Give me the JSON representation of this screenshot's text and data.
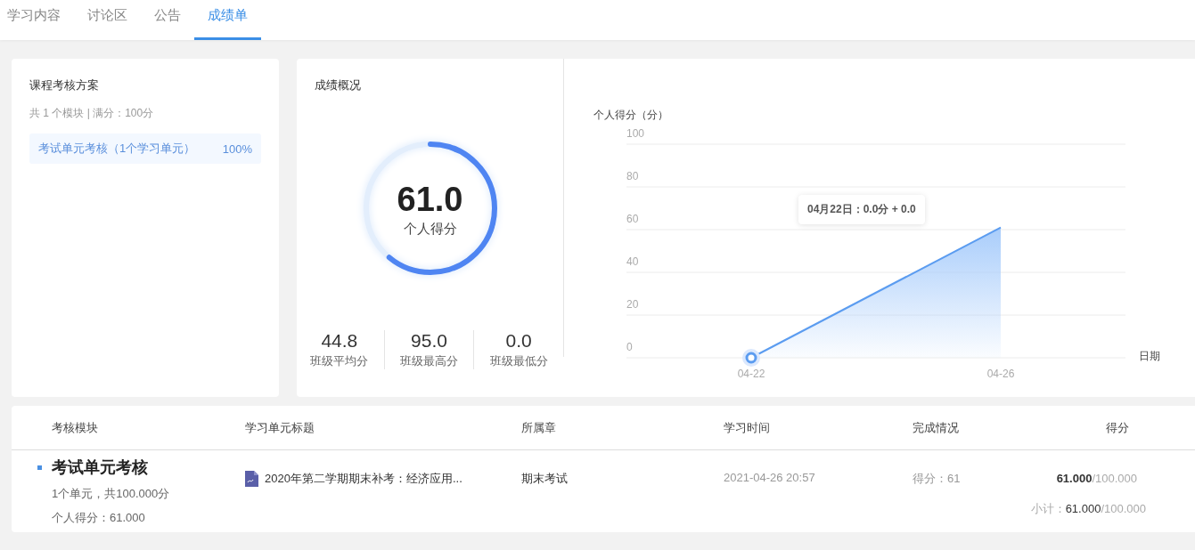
{
  "tabs": [
    {
      "label": "学习内容",
      "selected": false
    },
    {
      "label": "讨论区",
      "selected": false
    },
    {
      "label": "公告",
      "selected": false
    },
    {
      "label": "成绩单",
      "selected": true
    }
  ],
  "scheme": {
    "title": "课程考核方案",
    "summary": "共 1 个模块 | 满分：100分",
    "items": [
      {
        "label": "考试单元考核（1个学习单元）",
        "percent": "100%",
        "selected": true
      }
    ]
  },
  "overview": {
    "title": "成绩概况",
    "score": {
      "value": "61.0",
      "label": "个人得分",
      "level": 0.61
    },
    "stats": [
      {
        "value": "44.8",
        "label": "班级平均分"
      },
      {
        "value": "95.0",
        "label": "班级最高分"
      },
      {
        "value": "0.0",
        "label": "班级最低分"
      }
    ],
    "chart_data": {
      "type": "area",
      "ylabel": "个人得分（分）",
      "xlabel": "日期",
      "categories": [
        "04-22",
        "04-26"
      ],
      "series": [
        {
          "color": "#5b9cf0",
          "values": [
            0,
            61
          ]
        }
      ],
      "grid": true,
      "ylim": [
        0,
        100
      ],
      "yticks": [
        0,
        20,
        40,
        60,
        80,
        100
      ],
      "annotations": [
        "04月22日：0.0分 + 0.0"
      ]
    }
  },
  "table": {
    "columns": [
      "考核模块",
      "学习单元标题",
      "所属章",
      "学习时间",
      "完成情况",
      "得分"
    ],
    "rows": [
      {
        "module": "考试单元考核",
        "units": "1个单元，共100.000分",
        "personal": "个人得分：61.000",
        "title": "2020年第二学期期末补考：经济应用...",
        "chapter": "期末考试",
        "time": "2021-04-26 20:57",
        "completion": "得分：61",
        "score": "**61.000**/100.000",
        "subtotal": "小计：**61.000**/100.000"
      }
    ]
  }
}
